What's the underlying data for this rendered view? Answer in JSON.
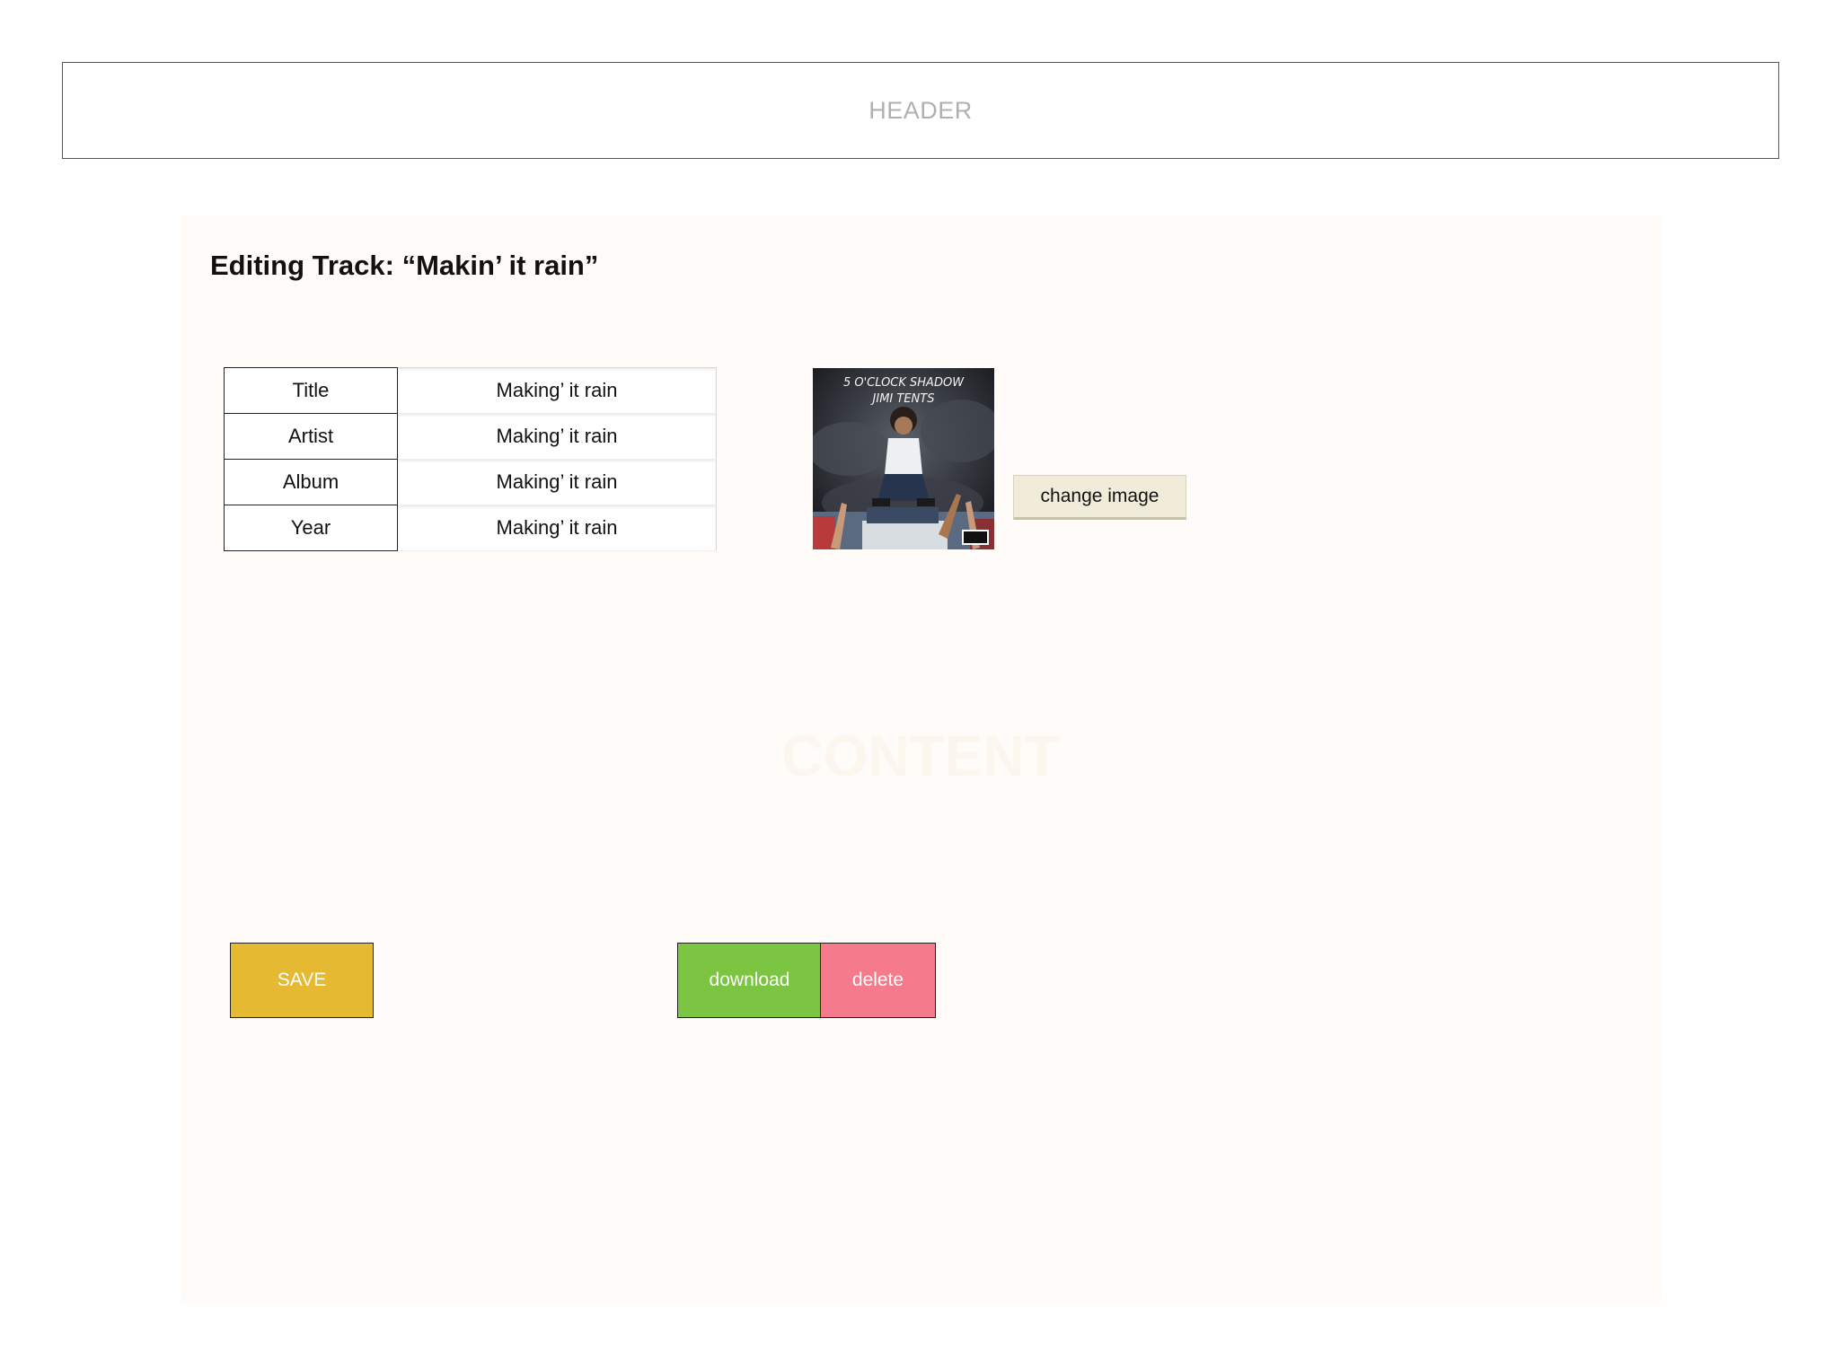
{
  "header": {
    "label": "HEADER"
  },
  "content": {
    "watermark": "CONTENT",
    "title": "Editing Track: “Makin’ it rain”"
  },
  "fields": [
    {
      "label": "Title",
      "value": "Making’ it rain"
    },
    {
      "label": "Artist",
      "value": "Making’ it rain"
    },
    {
      "label": "Album",
      "value": "Making’ it rain"
    },
    {
      "label": "Year",
      "value": "Making’ it rain"
    }
  ],
  "album_art": {
    "line1": "5 O'CLOCK SHADOW",
    "line2": "JIMI TENTS",
    "advisory": "PARENTAL ADVISORY"
  },
  "buttons": {
    "change_image": "change image",
    "save": "SAVE",
    "download": "download",
    "delete": "delete"
  },
  "colors": {
    "save": "#e5b931",
    "download": "#7bc542",
    "delete": "#f57a8b",
    "change_image": "#f1ecd9",
    "content_bg": "#fefbf8"
  }
}
